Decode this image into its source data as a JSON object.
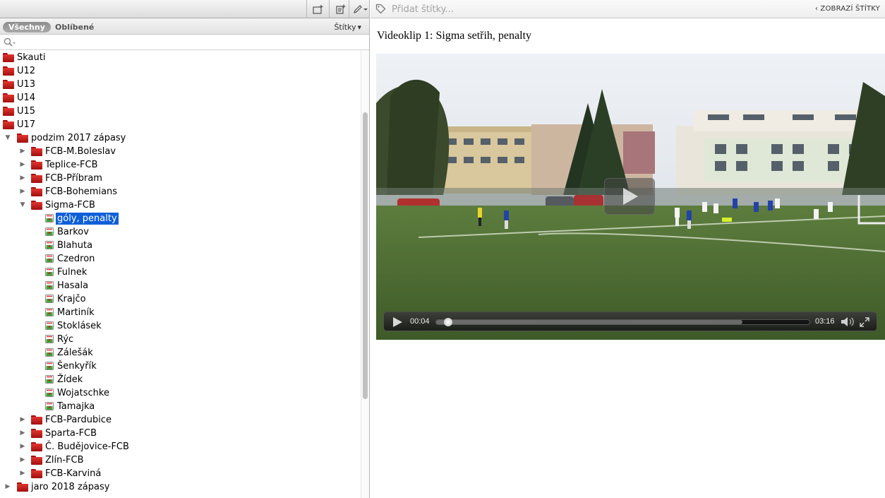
{
  "left": {
    "filters": {
      "all": "Všechny",
      "favorites": "Oblíbené",
      "tags": "Štítky"
    },
    "search": {
      "placeholder": ""
    },
    "tree": [
      {
        "label": "Skauti",
        "kind": "folder",
        "depth": 0,
        "expanded": null
      },
      {
        "label": "U12",
        "kind": "folder",
        "depth": 0,
        "expanded": null
      },
      {
        "label": "U13",
        "kind": "folder",
        "depth": 0,
        "expanded": null
      },
      {
        "label": "U14",
        "kind": "folder",
        "depth": 0,
        "expanded": null
      },
      {
        "label": "U15",
        "kind": "folder",
        "depth": 0,
        "expanded": null
      },
      {
        "label": "U17",
        "kind": "folder",
        "depth": 0,
        "expanded": null
      },
      {
        "label": "podzim 2017 zápasy",
        "kind": "folder",
        "depth": 1,
        "expanded": true
      },
      {
        "label": "FCB-M.Boleslav",
        "kind": "folder",
        "depth": 2,
        "expanded": false
      },
      {
        "label": "Teplice-FCB",
        "kind": "folder",
        "depth": 2,
        "expanded": false
      },
      {
        "label": "FCB-Příbram",
        "kind": "folder",
        "depth": 2,
        "expanded": false
      },
      {
        "label": "FCB-Bohemians",
        "kind": "folder",
        "depth": 2,
        "expanded": false
      },
      {
        "label": "Sigma-FCB",
        "kind": "folder",
        "depth": 2,
        "expanded": true
      },
      {
        "label": "góly, penalty",
        "kind": "video",
        "depth": 3,
        "selected": true
      },
      {
        "label": "Barkov",
        "kind": "video",
        "depth": 3
      },
      {
        "label": "Blahuta",
        "kind": "video",
        "depth": 3
      },
      {
        "label": "Czedron",
        "kind": "video",
        "depth": 3
      },
      {
        "label": "Fulnek",
        "kind": "video",
        "depth": 3
      },
      {
        "label": "Hasala",
        "kind": "video",
        "depth": 3
      },
      {
        "label": "Krajčo",
        "kind": "video",
        "depth": 3
      },
      {
        "label": "Martiník",
        "kind": "video",
        "depth": 3
      },
      {
        "label": "Stoklásek",
        "kind": "video",
        "depth": 3
      },
      {
        "label": "Rýc",
        "kind": "video",
        "depth": 3
      },
      {
        "label": "Zálešák",
        "kind": "video",
        "depth": 3
      },
      {
        "label": "Šenkyřík",
        "kind": "video",
        "depth": 3
      },
      {
        "label": "Žídek",
        "kind": "video",
        "depth": 3
      },
      {
        "label": "Wojatschke",
        "kind": "video",
        "depth": 3
      },
      {
        "label": "Tamajka",
        "kind": "video",
        "depth": 3
      },
      {
        "label": "FCB-Pardubice",
        "kind": "folder",
        "depth": 2,
        "expanded": false
      },
      {
        "label": "Sparta-FCB",
        "kind": "folder",
        "depth": 2,
        "expanded": false
      },
      {
        "label": "Č. Budějovice-FCB",
        "kind": "folder",
        "depth": 2,
        "expanded": false
      },
      {
        "label": "Zlín-FCB",
        "kind": "folder",
        "depth": 2,
        "expanded": false
      },
      {
        "label": "FCB-Karviná",
        "kind": "folder",
        "depth": 2,
        "expanded": false
      },
      {
        "label": "jaro 2018 zápasy",
        "kind": "folder",
        "depth": 1,
        "expanded": false
      }
    ]
  },
  "right": {
    "tags_placeholder": "Přidat štítky...",
    "show_tags": "‹ ZOBRAZÍ ŠTÍTKY",
    "clip_title": "Videoklip 1: Sigma setřih, penalty",
    "player": {
      "current_time": "00:04",
      "duration": "03:16",
      "progress": 0.02,
      "buffered": 0.82
    }
  },
  "colors": {
    "selection": "#0e5fd8",
    "folder": "#c41e1a"
  }
}
